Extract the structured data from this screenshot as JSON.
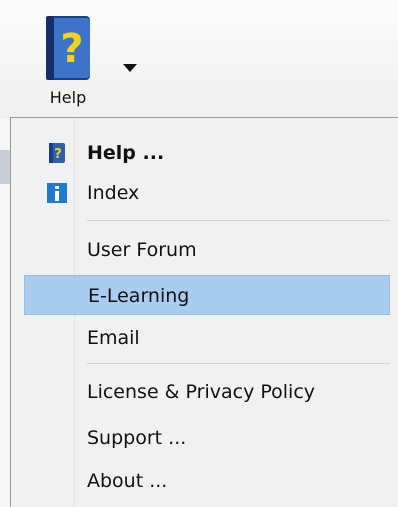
{
  "ribbon": {
    "help_button_label": "Help",
    "help_icon": "help-book-icon",
    "dropdown_icon": "chevron-down-icon"
  },
  "menu": {
    "items": [
      {
        "label": "Help ...",
        "icon": "help-book-icon",
        "bold": true
      },
      {
        "label": "Index",
        "icon": "info-icon"
      },
      {
        "label": "User Forum"
      },
      {
        "label": "E-Learning",
        "selected": true
      },
      {
        "label": "Email"
      },
      {
        "label": "License & Privacy Policy"
      },
      {
        "label": "Support ..."
      },
      {
        "label": "About ..."
      }
    ]
  },
  "colors": {
    "selection": "#a9cdef",
    "info_icon": "#1e7ad6",
    "book_icon": "#2c5fb0",
    "question_mark": "#f2d21a"
  }
}
